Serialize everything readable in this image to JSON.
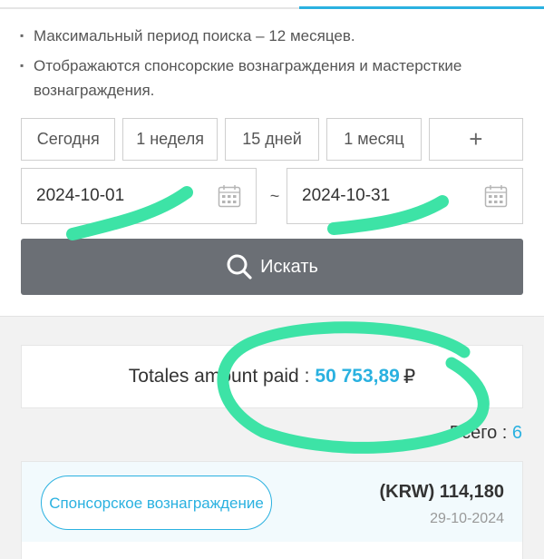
{
  "notes": [
    {
      "text": "Максимальный период поиска – 12 месяцев."
    },
    {
      "text": "Отображаются спонсорские вознаграждения и мастерсткие вознаграждения."
    }
  ],
  "periods": [
    "Сегодня",
    "1 неделя",
    "15 дней",
    "1 месяц",
    "+"
  ],
  "date_range": {
    "start": "2024-10-01",
    "separator": "~",
    "end": "2024-10-31"
  },
  "search_button": {
    "label": "Искать",
    "icon": "search-icon"
  },
  "total": {
    "label": "Totales amount paid : ",
    "amount": "50 753,89",
    "currency": "₽"
  },
  "count": {
    "label": "Всего : ",
    "value": "6"
  },
  "record": {
    "type": "Спонсорское вознаграждение",
    "amount": "(KRW) 114,180",
    "date": "29-10-2024"
  },
  "colors": {
    "accent": "#2ab1e0",
    "button": "#6b6f75",
    "marker": "#3de3a6"
  }
}
